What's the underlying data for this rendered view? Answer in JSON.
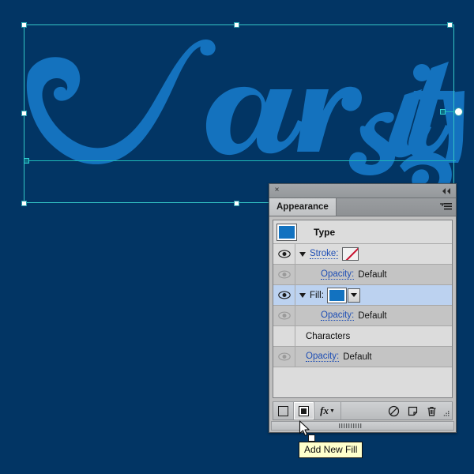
{
  "app": {
    "canvas_bg_color": "#023564",
    "artwork_color": "#1472be",
    "artwork_text": "Varsity",
    "selection_color": "#34c6c6"
  },
  "panel": {
    "title": "Appearance",
    "close_icon": "close-icon",
    "collapse_icon": "collapse-panel-icon",
    "menu_icon": "panel-menu-icon",
    "rows": [
      {
        "name": "type",
        "label": "Type",
        "kind": "object-header",
        "eye": false,
        "disclosure": false,
        "swatch": "blue"
      },
      {
        "name": "stroke",
        "label": "Stroke:",
        "kind": "attribute",
        "eye": true,
        "eye_state": "visible",
        "disclosure": true,
        "swatch": "none"
      },
      {
        "name": "stroke-opacity",
        "label": "Opacity:",
        "value": "Default",
        "kind": "opacity",
        "eye": true,
        "eye_state": "dim",
        "disclosure": false
      },
      {
        "name": "fill",
        "label": "Fill:",
        "kind": "attribute",
        "eye": true,
        "eye_state": "visible",
        "disclosure": true,
        "swatch": "blue-dropdown",
        "selected": true
      },
      {
        "name": "fill-opacity",
        "label": "Opacity:",
        "value": "Default",
        "kind": "opacity",
        "eye": true,
        "eye_state": "dim",
        "disclosure": false
      },
      {
        "name": "characters",
        "label": "Characters",
        "kind": "group-header",
        "eye": false,
        "disclosure": false
      },
      {
        "name": "characters-opacity",
        "label": "Opacity:",
        "value": "Default",
        "kind": "opacity",
        "eye": true,
        "eye_state": "dim",
        "disclosure": false
      }
    ],
    "toolbar": {
      "add_new_stroke": "add-new-stroke-icon",
      "add_new_fill": "add-new-fill-icon",
      "add_new_effect": "fx",
      "clear_appearance": "clear-appearance-icon",
      "duplicate_item": "duplicate-item-icon",
      "delete_item": "delete-item-icon",
      "resize_grip": "resize-grip-icon"
    }
  },
  "tooltip": {
    "text": "Add New Fill"
  },
  "cursor": {
    "type": "arrow-pointer"
  }
}
